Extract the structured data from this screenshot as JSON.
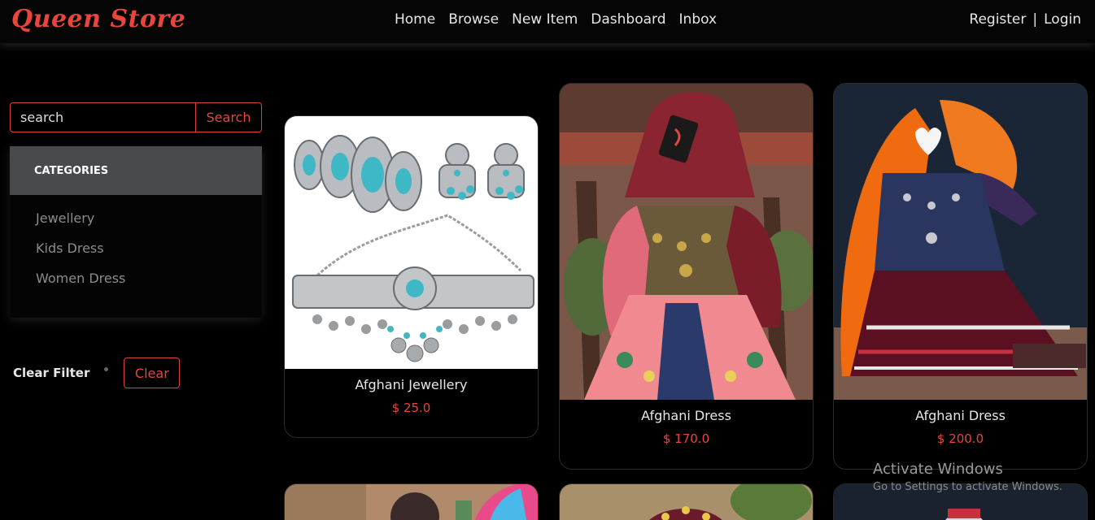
{
  "brand": "Queen Store",
  "nav": {
    "links": [
      "Home",
      "Browse",
      "New Item",
      "Dashboard",
      "Inbox"
    ],
    "register": "Register",
    "separator": "|",
    "login": "Login"
  },
  "search": {
    "placeholder": "search",
    "button": "Search"
  },
  "categories": {
    "header": "CATEGORIES",
    "items": [
      "Jewellery",
      "Kids Dress",
      "Women Dress"
    ]
  },
  "filter": {
    "label": "Clear Filter",
    "button": "Clear"
  },
  "products": [
    {
      "name": "Afghani Jewellery",
      "price": "$ 25.0"
    },
    {
      "name": "Afghani Dress",
      "price": "$ 170.0"
    },
    {
      "name": "Afghani Dress",
      "price": "$ 200.0"
    }
  ],
  "watermark": {
    "title": "Activate Windows",
    "subtitle": "Go to Settings to activate Windows."
  },
  "colors": {
    "accent": "#e8453c",
    "background": "#000000",
    "category_header": "#494a4c"
  }
}
